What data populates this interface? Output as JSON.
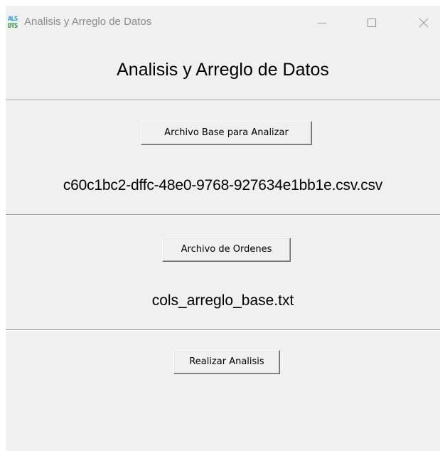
{
  "window": {
    "title": "Analisis y Arreglo de Datos",
    "icon": {
      "name": "als-dts-app-icon",
      "line1": "ALS",
      "line2": "DTS"
    },
    "controls": [
      "minimize-icon",
      "maximize-icon",
      "close-icon"
    ]
  },
  "main": {
    "heading": "Analisis y Arreglo de Datos",
    "base_section": {
      "button_label": "Archivo Base para Analizar",
      "selected_file": "c60c1bc2-dffc-48e0-9768-927634e1bb1e.csv.csv"
    },
    "orders_section": {
      "button_label": "Archivo de Ordenes",
      "selected_file": "cols_arreglo_base.txt"
    },
    "analysis_section": {
      "button_label": "Realizar Analisis"
    }
  },
  "colors": {
    "window_background": "#f0f0f0",
    "title_text": "#8a8a8a",
    "separator": "#a0a0a0",
    "icon_blue": "#1a9ad8",
    "icon_green": "#2a8f3a"
  }
}
